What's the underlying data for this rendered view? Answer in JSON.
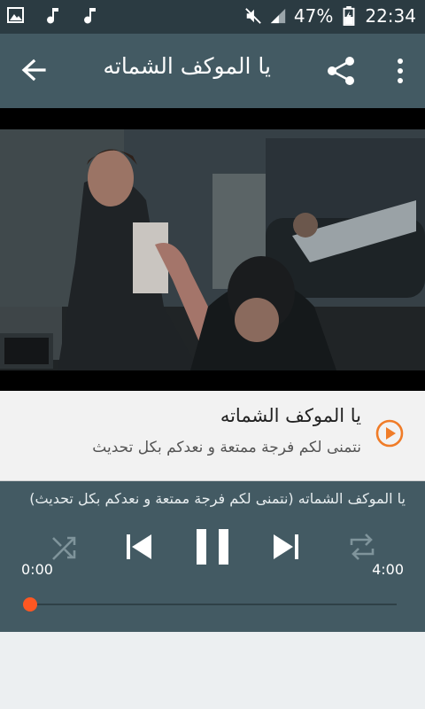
{
  "status_bar": {
    "battery": "47%",
    "time": "22:34",
    "icons": [
      "image-icon",
      "music-note-icon",
      "music-note-icon",
      "mute-icon",
      "signal-icon",
      "battery-icon"
    ]
  },
  "app_bar": {
    "title": "يا الموكف الشماته",
    "back_icon": "arrow-back-icon",
    "share_icon": "share-icon",
    "more_icon": "more-vert-icon"
  },
  "track": {
    "title": "يا الموكف الشماته",
    "subtitle": "نتمنى لكم فرجة ممتعة و نعدكم بكل تحديث",
    "icon": "play-circle-icon",
    "accent": "#f07c28"
  },
  "player": {
    "now_playing": "يا الموكف الشماته (نتمنى لكم فرجة ممتعة و نعدكم بكل تحديث)",
    "time_current": "0:00",
    "time_total": "4:00",
    "progress": 0.0,
    "controls": [
      "shuffle-icon",
      "previous-icon",
      "pause-icon",
      "next-icon",
      "repeat-icon"
    ],
    "accent": "#ff5722"
  }
}
